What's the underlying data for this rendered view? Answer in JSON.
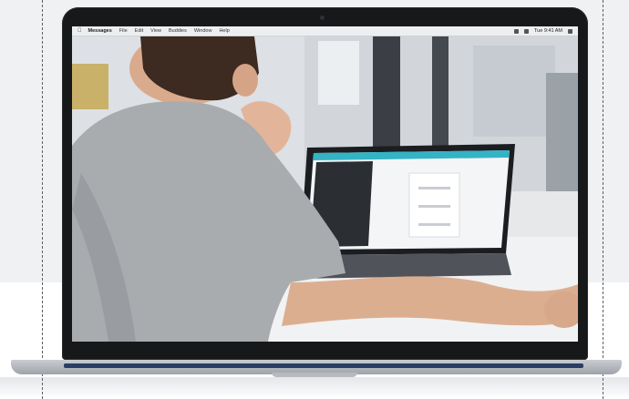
{
  "menubar": {
    "apple_icon": "apple-logo",
    "app_name": "Messages",
    "menus": [
      "File",
      "Edit",
      "View",
      "Buddies",
      "Window",
      "Help"
    ],
    "clock": "Tue 9:41 AM"
  },
  "colors": {
    "background": "#f0f1f3",
    "laptop_bezel": "#17181a",
    "laptop_aluminum": "#b7bbc1",
    "shirt": "#a9acaf",
    "inner_screen_header": "#34b3c5"
  }
}
